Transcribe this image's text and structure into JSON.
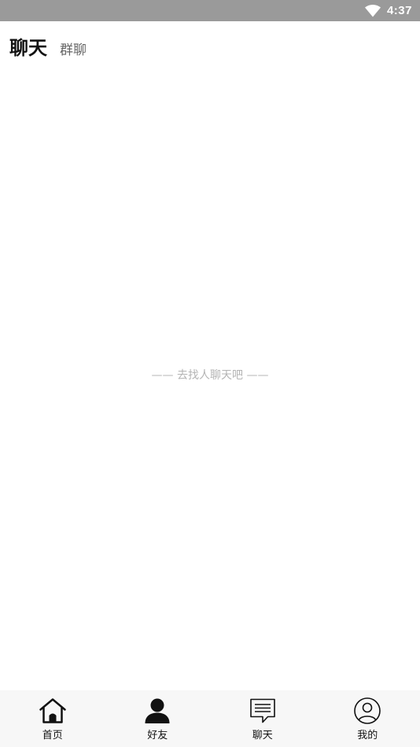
{
  "status_bar": {
    "time": "4:37",
    "icons": [
      "wifi-icon"
    ]
  },
  "header": {
    "tabs": [
      {
        "label": "聊天",
        "active": true
      },
      {
        "label": "群聊",
        "active": false
      }
    ]
  },
  "main": {
    "empty_hint": "—— 去找人聊天吧 ——"
  },
  "bottom_nav": {
    "items": [
      {
        "label": "首页",
        "icon": "home-icon"
      },
      {
        "label": "好友",
        "icon": "person-icon"
      },
      {
        "label": "聊天",
        "icon": "chat-icon"
      },
      {
        "label": "我的",
        "icon": "profile-icon"
      }
    ]
  },
  "colors": {
    "status_bar_bg": "#9a9a9a",
    "bottom_nav_bg": "#f7f7f7",
    "hint_text": "#b4b4b4"
  }
}
